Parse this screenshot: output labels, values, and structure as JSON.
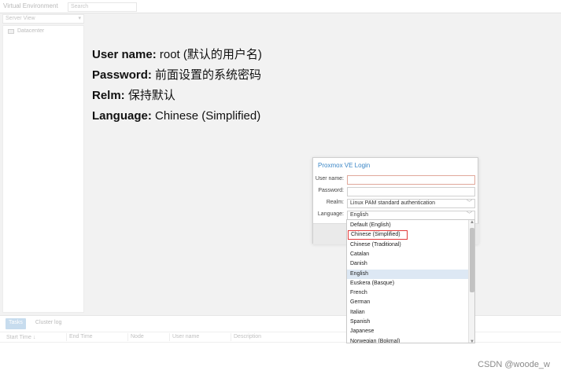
{
  "topbar": {
    "env_label": "Virtual Environment",
    "search_placeholder": "Search"
  },
  "left": {
    "view_select": "Server View",
    "tree_root": "Datacenter"
  },
  "notes": [
    {
      "key": "User name:",
      "val": " root (默认的用户名)"
    },
    {
      "key": "Password:",
      "val": " 前面设置的系统密码"
    },
    {
      "key": "Relm:",
      "val": " 保持默认"
    },
    {
      "key": "Language:",
      "val": " Chinese (Simplified)"
    }
  ],
  "dialog": {
    "title": "Proxmox VE Login",
    "username_label": "User name:",
    "username_value": "",
    "password_label": "Password:",
    "password_value": "",
    "realm_label": "Realm:",
    "realm_value": "Linux PAM standard authentication",
    "language_label": "Language:",
    "language_value": "English"
  },
  "language_options": [
    "Default (English)",
    "Chinese (Simplified)",
    "Chinese (Traditional)",
    "Catalan",
    "Danish",
    "English",
    "Euskera (Basque)",
    "French",
    "German",
    "Italian",
    "Spanish",
    "Japanese",
    "Norwegian (Bokmal)"
  ],
  "bottom": {
    "tabs": [
      "Tasks",
      "Cluster log"
    ],
    "columns": [
      "Start Time ↓",
      "End Time",
      "Node",
      "User name",
      "Description"
    ]
  },
  "watermark": "CSDN @woode_w",
  "colors": {
    "accent": "#3a86c6",
    "highlight_border": "#e23b3b",
    "selected_row": "#dde8f4"
  }
}
